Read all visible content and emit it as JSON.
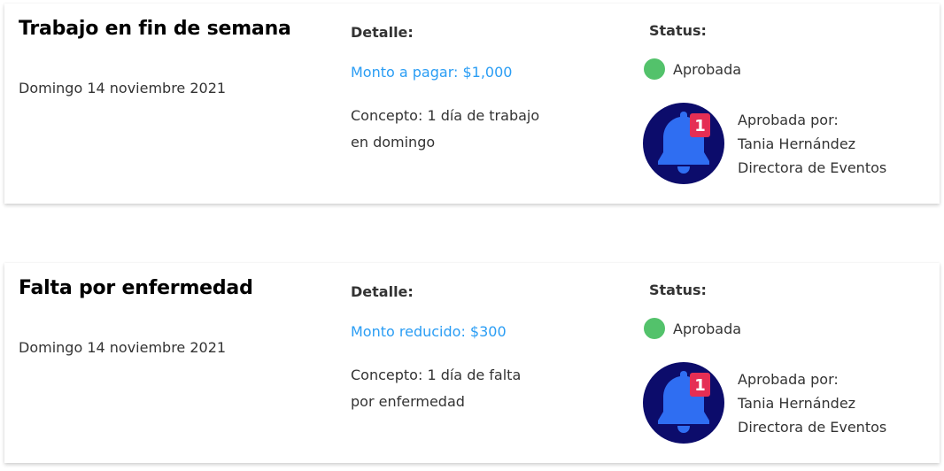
{
  "colors": {
    "accent_blue": "#2a9df4",
    "status_green": "#53c26b",
    "avatar_bg": "#0c0c6b",
    "bell_blue": "#2f6ef2",
    "badge_red": "#e52e54"
  },
  "requests": [
    {
      "title": "Trabajo en fin de semana",
      "date": "Domingo 14 noviembre 2021",
      "detail_heading": "Detalle:",
      "amount": "Monto a pagar: $1,000",
      "concept_line1": "Concepto: 1 día de trabajo",
      "concept_line2": "en domingo",
      "status_heading": "Status:",
      "status": "Aprobada",
      "approver_label": "Aprobada por:",
      "approver_name": "Tania Hernández",
      "approver_role": "Directora de Eventos",
      "avatar_icon": "bell-notification-icon",
      "badge_count": "1"
    },
    {
      "title": "Falta por enfermedad",
      "date": "Domingo 14 noviembre 2021",
      "detail_heading": "Detalle:",
      "amount": "Monto reducido: $300",
      "concept_line1": "Concepto: 1 día de falta",
      "concept_line2": "por enfermedad",
      "status_heading": "Status:",
      "status": "Aprobada",
      "approver_label": "Aprobada por:",
      "approver_name": "Tania Hernández",
      "approver_role": "Directora de Eventos",
      "avatar_icon": "bell-notification-icon",
      "badge_count": "1"
    }
  ]
}
